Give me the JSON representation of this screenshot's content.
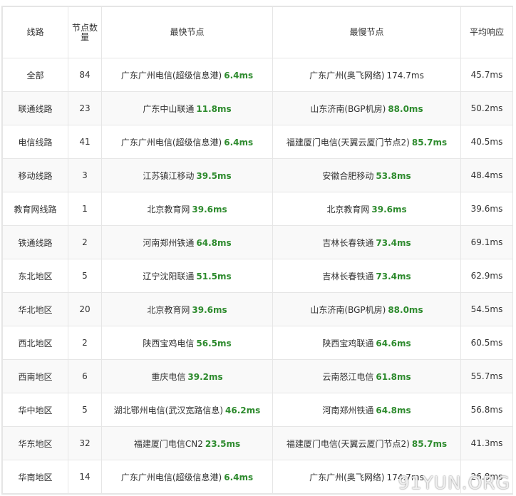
{
  "table": {
    "headers": [
      "线路",
      "节点数量",
      "最快节点",
      "最慢节点",
      "平均响应"
    ],
    "rows": [
      {
        "line": "全部",
        "count": "84",
        "fast_node": "广东广州电信(超级信息港)",
        "fast_ms": "6.4ms",
        "slow_node": "广东广州(奥飞网络)",
        "slow_ms": "174.7ms",
        "avg": "45.7ms"
      },
      {
        "line": "联通线路",
        "count": "23",
        "fast_node": "广东中山联通",
        "fast_ms": "11.8ms",
        "slow_node": "山东济南(BGP机房)",
        "slow_ms": "88.0ms",
        "avg": "50.2ms"
      },
      {
        "line": "电信线路",
        "count": "41",
        "fast_node": "广东广州电信(超级信息港)",
        "fast_ms": "6.4ms",
        "slow_node": "福建厦门电信(天翼云厦门节点2)",
        "slow_ms": "85.7ms",
        "avg": "40.5ms"
      },
      {
        "line": "移动线路",
        "count": "3",
        "fast_node": "江苏镇江移动",
        "fast_ms": "39.5ms",
        "slow_node": "安徽合肥移动",
        "slow_ms": "53.8ms",
        "avg": "48.4ms"
      },
      {
        "line": "教育网线路",
        "count": "1",
        "fast_node": "北京教育网",
        "fast_ms": "39.6ms",
        "slow_node": "北京教育网",
        "slow_ms": "39.6ms",
        "avg": "39.6ms"
      },
      {
        "line": "铁通线路",
        "count": "2",
        "fast_node": "河南郑州铁通",
        "fast_ms": "64.8ms",
        "slow_node": "吉林长春铁通",
        "slow_ms": "73.4ms",
        "avg": "69.1ms"
      },
      {
        "line": "东北地区",
        "count": "5",
        "fast_node": "辽宁沈阳联通",
        "fast_ms": "51.5ms",
        "slow_node": "吉林长春铁通",
        "slow_ms": "73.4ms",
        "avg": "62.9ms"
      },
      {
        "line": "华北地区",
        "count": "20",
        "fast_node": "北京教育网",
        "fast_ms": "39.6ms",
        "slow_node": "山东济南(BGP机房)",
        "slow_ms": "88.0ms",
        "avg": "54.5ms"
      },
      {
        "line": "西北地区",
        "count": "2",
        "fast_node": "陕西宝鸡电信",
        "fast_ms": "56.5ms",
        "slow_node": "陕西宝鸡联通",
        "slow_ms": "64.6ms",
        "avg": "60.5ms"
      },
      {
        "line": "西南地区",
        "count": "6",
        "fast_node": "重庆电信",
        "fast_ms": "39.2ms",
        "slow_node": "云南怒江电信",
        "slow_ms": "61.8ms",
        "avg": "55.7ms"
      },
      {
        "line": "华中地区",
        "count": "5",
        "fast_node": "湖北鄂州电信(武汉宽路信息)",
        "fast_ms": "46.2ms",
        "slow_node": "河南郑州铁通",
        "slow_ms": "64.8ms",
        "avg": "56.8ms"
      },
      {
        "line": "华东地区",
        "count": "32",
        "fast_node": "福建厦门电信CN2",
        "fast_ms": "23.5ms",
        "slow_node": "福建厦门电信(天翼云厦门节点2)",
        "slow_ms": "85.7ms",
        "avg": "41.3ms"
      },
      {
        "line": "华南地区",
        "count": "14",
        "fast_node": "广东广州电信(超级信息港)",
        "fast_ms": "6.4ms",
        "slow_node": "广东广州(奥飞网络)",
        "slow_ms": "174.7ms",
        "avg": "26.8ms"
      }
    ],
    "plain_slow_rows": [
      0,
      12
    ]
  },
  "watermark": "91YUN.ORG",
  "colors": {
    "ms_highlight": "#2e8b2e",
    "border": "#e6e6e6",
    "text": "#333333"
  }
}
